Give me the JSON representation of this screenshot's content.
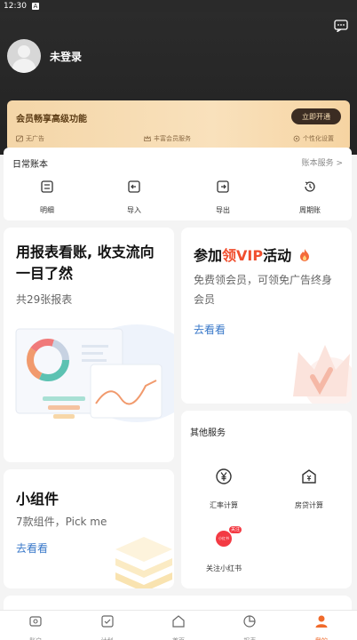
{
  "status_bar": {
    "time": "12:30",
    "sim_label": "A"
  },
  "profile": {
    "username": "未登录"
  },
  "vip_banner": {
    "title": "会员畅享高级功能",
    "button_label": "立即开通",
    "features": [
      "无广告",
      "丰富会员服务",
      "个性化设置"
    ]
  },
  "daily": {
    "title": "日常账本",
    "more_label": "账本服务 >",
    "items": [
      {
        "label": "明细",
        "icon": "list-icon"
      },
      {
        "label": "导入",
        "icon": "import-icon"
      },
      {
        "label": "导出",
        "icon": "export-icon"
      },
      {
        "label": "周期账",
        "icon": "cycle-clock-icon"
      }
    ]
  },
  "report_card": {
    "title": "用报表看账, 收支流向一目了然",
    "subtitle": "共29张报表"
  },
  "vip_promo": {
    "title_prefix": "参加",
    "title_highlight": "领VIP",
    "title_suffix": "活动",
    "subtitle": "免费领会员，可领免广告终身会员",
    "link": "去看看"
  },
  "widget_card": {
    "title": "小组件",
    "subtitle": "7款组件，Pick me",
    "link": "去看看"
  },
  "services": {
    "title": "其他服务",
    "items": [
      {
        "label": "汇率计算",
        "icon": "yen-icon"
      },
      {
        "label": "房贷计算",
        "icon": "house-icon"
      },
      {
        "label": "关注小红书",
        "icon": "xiaohongshu-icon",
        "badge": "关注",
        "logo_text": "小红书"
      }
    ]
  },
  "tabbar": {
    "tabs": [
      {
        "label": "账户",
        "icon": "account-icon"
      },
      {
        "label": "计划",
        "icon": "plan-icon"
      },
      {
        "label": "首页",
        "icon": "home-icon"
      },
      {
        "label": "报表",
        "icon": "report-icon"
      },
      {
        "label": "我的",
        "icon": "me-icon",
        "active": true
      }
    ]
  },
  "colors": {
    "accent": "#f06a2b",
    "link": "#3978c9",
    "highlight": "#f04e2e",
    "header": "#2b2b2b"
  }
}
